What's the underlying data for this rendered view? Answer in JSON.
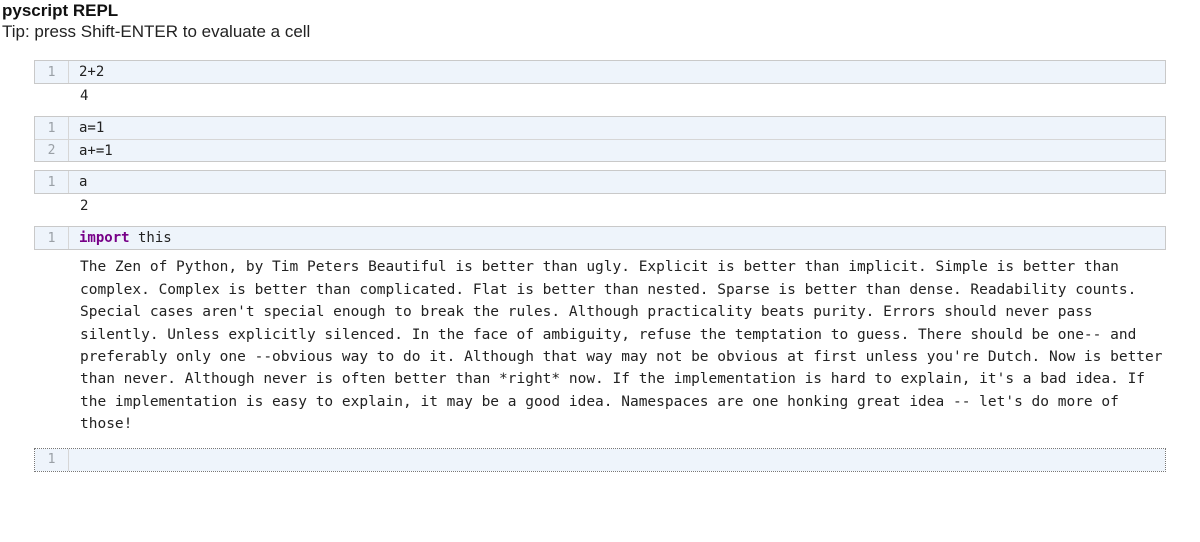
{
  "header": {
    "title": "pyscript REPL",
    "tip": "Tip: press Shift-ENTER to evaluate a cell"
  },
  "cells": [
    {
      "lines": [
        {
          "n": "1",
          "code": "2+2"
        }
      ],
      "output_kind": "value",
      "output": "4"
    },
    {
      "lines": [
        {
          "n": "1",
          "code": "a=1"
        },
        {
          "n": "2",
          "code": "a+=1"
        }
      ],
      "output_kind": "none",
      "output": ""
    },
    {
      "lines": [
        {
          "n": "1",
          "code": "a"
        }
      ],
      "output_kind": "value",
      "output": "2"
    },
    {
      "lines": [
        {
          "n": "1",
          "code_keyword": "import",
          "code_rest": " this"
        }
      ],
      "output_kind": "text",
      "output": "The Zen of Python, by Tim Peters Beautiful is better than ugly. Explicit is better than implicit. Simple is better than complex. Complex is better than complicated. Flat is better than nested. Sparse is better than dense. Readability counts. Special cases aren't special enough to break the rules. Although practicality beats purity. Errors should never pass silently. Unless explicitly silenced. In the face of ambiguity, refuse the temptation to guess. There should be one-- and preferably only one --obvious way to do it. Although that way may not be obvious at first unless you're Dutch. Now is better than never. Although never is often better than *right* now. If the implementation is hard to explain, it's a bad idea. If the implementation is easy to explain, it may be a good idea. Namespaces are one honking great idea -- let's do more of those!"
    },
    {
      "lines": [
        {
          "n": "1",
          "code": ""
        }
      ],
      "output_kind": "none",
      "output": "",
      "empty": true
    }
  ]
}
